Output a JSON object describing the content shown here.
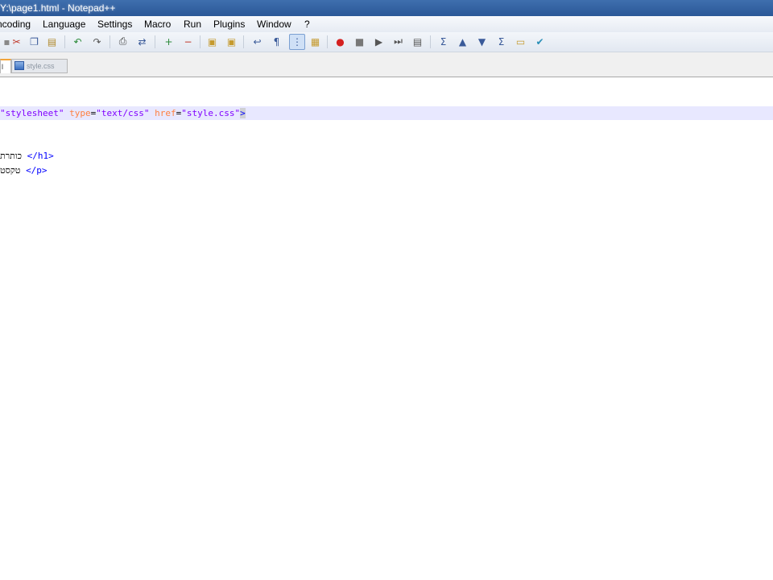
{
  "window": {
    "title": "Y:\\page1.html - Notepad++"
  },
  "menu": {
    "items": [
      "ncoding",
      "Language",
      "Settings",
      "Macro",
      "Run",
      "Plugins",
      "Window",
      "?"
    ]
  },
  "toolbar": {
    "icons": [
      "close-icon",
      "cut-icon",
      "copy-icon",
      "paste-icon",
      "undo-icon",
      "redo-icon",
      "print-icon",
      "replace-icon",
      "zoom-in-icon",
      "zoom-out-icon",
      "sync-vertical-icon",
      "sync-horizontal-icon",
      "word-wrap-icon",
      "all-chars-icon",
      "indent-guide-icon",
      "record-macro-icon",
      "stop-record-icon",
      "play-macro-icon",
      "play-multiple-icon",
      "save-macro-icon",
      "fold-icon",
      "prev-bookmark-icon",
      "next-bookmark-icon",
      "unfold-icon",
      "open-folder-icon",
      "check-icon"
    ]
  },
  "tabs": {
    "active_label": "l",
    "inactive_label": "style.css"
  },
  "editor": {
    "line1": {
      "s1": "\"stylesheet\"",
      "a1": "type",
      "eq1": "=",
      "s2": "\"text/css\"",
      "a2": "href",
      "eq2": "=",
      "s3": "\"style.css\"",
      "close": ">"
    },
    "line2": {
      "text": "כותרת ",
      "tag": "</h1>"
    },
    "line3": {
      "text": "טקסט ",
      "tag": "</p>"
    }
  }
}
